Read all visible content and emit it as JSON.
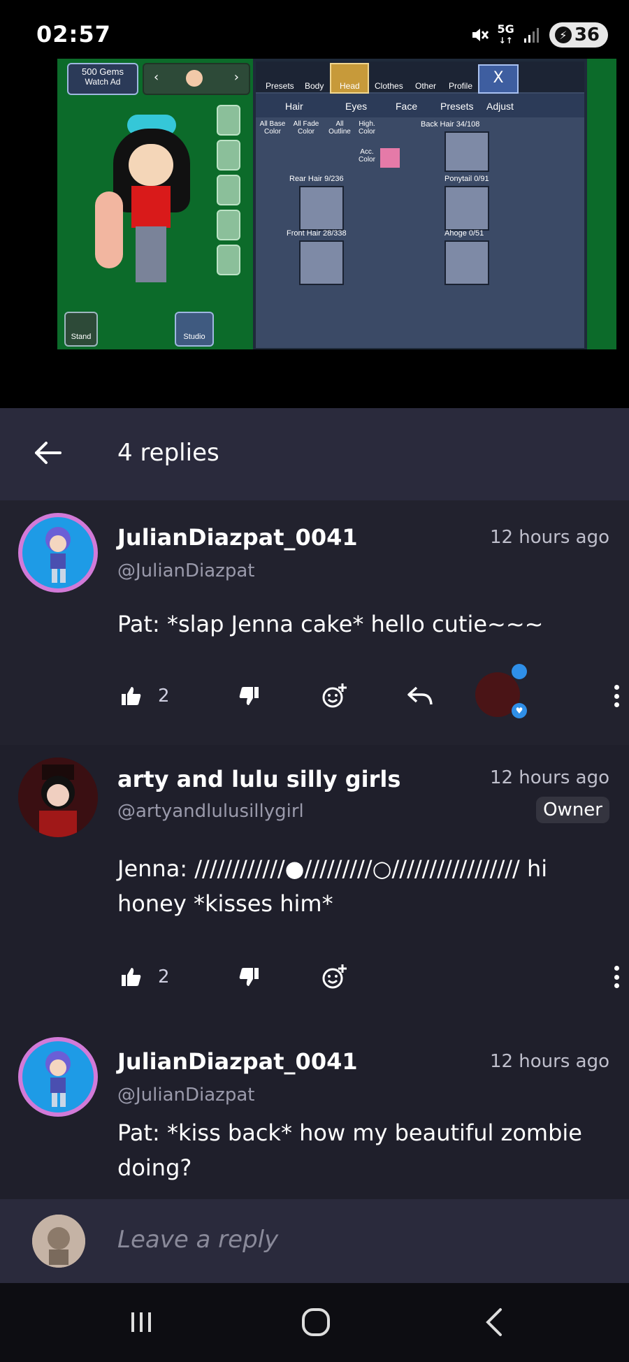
{
  "status_bar": {
    "time": "02:57",
    "network": "5G",
    "battery": "36"
  },
  "video": {
    "gems": "500 Gems",
    "watch_ad": "Watch Ad",
    "tabs": [
      "Presets",
      "Body",
      "Head",
      "Clothes",
      "Other",
      "Profile"
    ],
    "subtabs": [
      "Hair",
      "Eyes",
      "Face",
      "Presets",
      "Adjust"
    ],
    "color_labels": [
      "All Base Color",
      "All Fade Color",
      "All Outline",
      "High. Color",
      "Acc. Color"
    ],
    "slots": [
      "Back Hair 34/108",
      "Rear Hair 9/236",
      "Ponytail 0/91",
      "Front Hair 28/338",
      "Ahoge 0/51"
    ],
    "stand": "Stand",
    "studio": "Studio"
  },
  "header": {
    "title": "4 replies"
  },
  "comments": [
    {
      "username": "JulianDiazpat_0041",
      "handle": "@JulianDiazpat",
      "time": "12 hours ago",
      "text": "Pat: *slap Jenna cake* hello cutie~~~",
      "likes": "2"
    },
    {
      "username": "arty and lulu silly girls",
      "handle": "@artyandlulusillygirl",
      "time": "12 hours ago",
      "badge": "Owner",
      "text": "Jenna: ////////////●/////////○///////////////// hi honey *kisses him*",
      "likes": "2"
    },
    {
      "username": "JulianDiazpat_0041",
      "handle": "@JulianDiazpat",
      "time": "12 hours ago",
      "text": "Pat: *kiss back* how my beautiful zombie doing?"
    }
  ],
  "reply_bar": {
    "placeholder": "Leave a reply"
  },
  "colors": {
    "background": "#1f1f2b",
    "header": "#2a2a3c",
    "accent": "#4aa3ff"
  }
}
